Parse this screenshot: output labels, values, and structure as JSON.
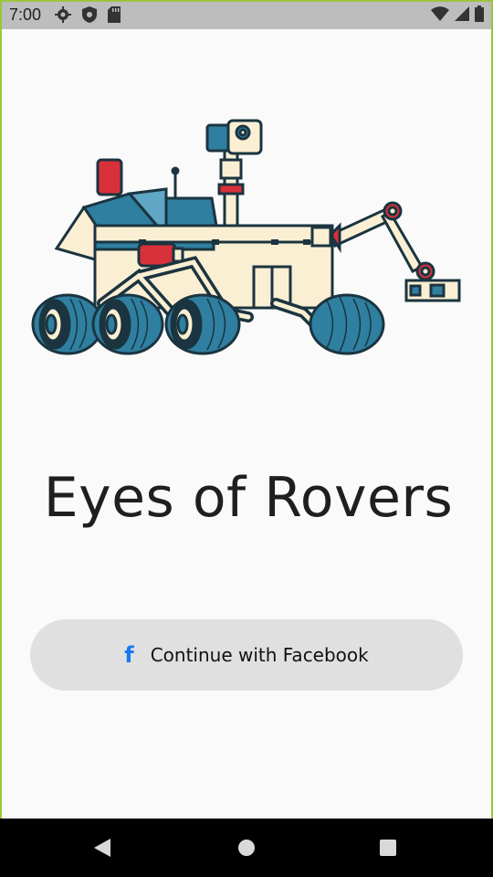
{
  "status_bar": {
    "time": "7:00",
    "left_icons": [
      "gear-icon",
      "shield-icon",
      "sd-card-icon"
    ],
    "right_icons": [
      "wifi-icon",
      "signal-icon",
      "battery-icon"
    ]
  },
  "app": {
    "title": "Eyes of Rovers",
    "logo": "rover-illustration"
  },
  "login": {
    "facebook_icon": "f",
    "facebook_label": "Continue with Facebook"
  },
  "nav_bar": {
    "buttons": [
      "back-icon",
      "home-icon",
      "recents-icon"
    ]
  },
  "colors": {
    "status_bar": "#bdbdbd",
    "background": "#fafafa",
    "button_bg": "#e0e0e0",
    "facebook_blue": "#1877f2",
    "frame_border": "#9bc53d",
    "rover_teal": "#2f7fa0",
    "rover_cream": "#fbefd3",
    "rover_red": "#d8313a",
    "rover_outline": "#1b3440"
  }
}
